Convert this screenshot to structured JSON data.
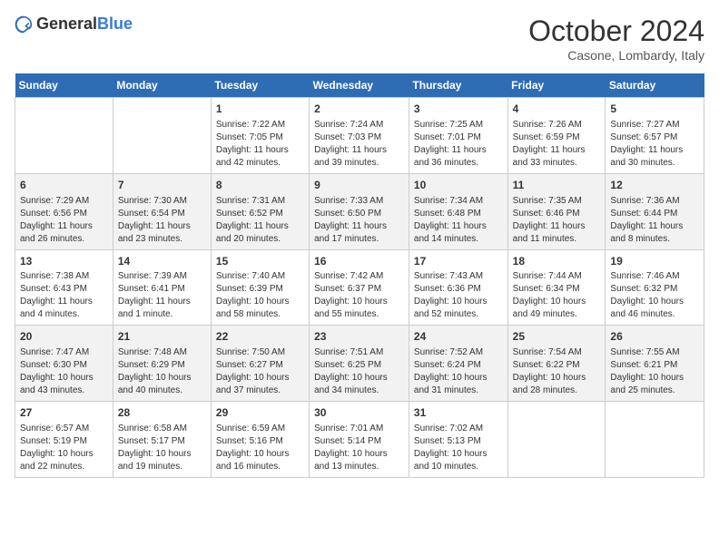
{
  "header": {
    "logo_general": "General",
    "logo_blue": "Blue",
    "month_title": "October 2024",
    "location": "Casone, Lombardy, Italy"
  },
  "weekdays": [
    "Sunday",
    "Monday",
    "Tuesday",
    "Wednesday",
    "Thursday",
    "Friday",
    "Saturday"
  ],
  "weeks": [
    [
      {
        "day": "",
        "sunrise": "",
        "sunset": "",
        "daylight": ""
      },
      {
        "day": "",
        "sunrise": "",
        "sunset": "",
        "daylight": ""
      },
      {
        "day": "1",
        "sunrise": "Sunrise: 7:22 AM",
        "sunset": "Sunset: 7:05 PM",
        "daylight": "Daylight: 11 hours and 42 minutes."
      },
      {
        "day": "2",
        "sunrise": "Sunrise: 7:24 AM",
        "sunset": "Sunset: 7:03 PM",
        "daylight": "Daylight: 11 hours and 39 minutes."
      },
      {
        "day": "3",
        "sunrise": "Sunrise: 7:25 AM",
        "sunset": "Sunset: 7:01 PM",
        "daylight": "Daylight: 11 hours and 36 minutes."
      },
      {
        "day": "4",
        "sunrise": "Sunrise: 7:26 AM",
        "sunset": "Sunset: 6:59 PM",
        "daylight": "Daylight: 11 hours and 33 minutes."
      },
      {
        "day": "5",
        "sunrise": "Sunrise: 7:27 AM",
        "sunset": "Sunset: 6:57 PM",
        "daylight": "Daylight: 11 hours and 30 minutes."
      }
    ],
    [
      {
        "day": "6",
        "sunrise": "Sunrise: 7:29 AM",
        "sunset": "Sunset: 6:56 PM",
        "daylight": "Daylight: 11 hours and 26 minutes."
      },
      {
        "day": "7",
        "sunrise": "Sunrise: 7:30 AM",
        "sunset": "Sunset: 6:54 PM",
        "daylight": "Daylight: 11 hours and 23 minutes."
      },
      {
        "day": "8",
        "sunrise": "Sunrise: 7:31 AM",
        "sunset": "Sunset: 6:52 PM",
        "daylight": "Daylight: 11 hours and 20 minutes."
      },
      {
        "day": "9",
        "sunrise": "Sunrise: 7:33 AM",
        "sunset": "Sunset: 6:50 PM",
        "daylight": "Daylight: 11 hours and 17 minutes."
      },
      {
        "day": "10",
        "sunrise": "Sunrise: 7:34 AM",
        "sunset": "Sunset: 6:48 PM",
        "daylight": "Daylight: 11 hours and 14 minutes."
      },
      {
        "day": "11",
        "sunrise": "Sunrise: 7:35 AM",
        "sunset": "Sunset: 6:46 PM",
        "daylight": "Daylight: 11 hours and 11 minutes."
      },
      {
        "day": "12",
        "sunrise": "Sunrise: 7:36 AM",
        "sunset": "Sunset: 6:44 PM",
        "daylight": "Daylight: 11 hours and 8 minutes."
      }
    ],
    [
      {
        "day": "13",
        "sunrise": "Sunrise: 7:38 AM",
        "sunset": "Sunset: 6:43 PM",
        "daylight": "Daylight: 11 hours and 4 minutes."
      },
      {
        "day": "14",
        "sunrise": "Sunrise: 7:39 AM",
        "sunset": "Sunset: 6:41 PM",
        "daylight": "Daylight: 11 hours and 1 minute."
      },
      {
        "day": "15",
        "sunrise": "Sunrise: 7:40 AM",
        "sunset": "Sunset: 6:39 PM",
        "daylight": "Daylight: 10 hours and 58 minutes."
      },
      {
        "day": "16",
        "sunrise": "Sunrise: 7:42 AM",
        "sunset": "Sunset: 6:37 PM",
        "daylight": "Daylight: 10 hours and 55 minutes."
      },
      {
        "day": "17",
        "sunrise": "Sunrise: 7:43 AM",
        "sunset": "Sunset: 6:36 PM",
        "daylight": "Daylight: 10 hours and 52 minutes."
      },
      {
        "day": "18",
        "sunrise": "Sunrise: 7:44 AM",
        "sunset": "Sunset: 6:34 PM",
        "daylight": "Daylight: 10 hours and 49 minutes."
      },
      {
        "day": "19",
        "sunrise": "Sunrise: 7:46 AM",
        "sunset": "Sunset: 6:32 PM",
        "daylight": "Daylight: 10 hours and 46 minutes."
      }
    ],
    [
      {
        "day": "20",
        "sunrise": "Sunrise: 7:47 AM",
        "sunset": "Sunset: 6:30 PM",
        "daylight": "Daylight: 10 hours and 43 minutes."
      },
      {
        "day": "21",
        "sunrise": "Sunrise: 7:48 AM",
        "sunset": "Sunset: 6:29 PM",
        "daylight": "Daylight: 10 hours and 40 minutes."
      },
      {
        "day": "22",
        "sunrise": "Sunrise: 7:50 AM",
        "sunset": "Sunset: 6:27 PM",
        "daylight": "Daylight: 10 hours and 37 minutes."
      },
      {
        "day": "23",
        "sunrise": "Sunrise: 7:51 AM",
        "sunset": "Sunset: 6:25 PM",
        "daylight": "Daylight: 10 hours and 34 minutes."
      },
      {
        "day": "24",
        "sunrise": "Sunrise: 7:52 AM",
        "sunset": "Sunset: 6:24 PM",
        "daylight": "Daylight: 10 hours and 31 minutes."
      },
      {
        "day": "25",
        "sunrise": "Sunrise: 7:54 AM",
        "sunset": "Sunset: 6:22 PM",
        "daylight": "Daylight: 10 hours and 28 minutes."
      },
      {
        "day": "26",
        "sunrise": "Sunrise: 7:55 AM",
        "sunset": "Sunset: 6:21 PM",
        "daylight": "Daylight: 10 hours and 25 minutes."
      }
    ],
    [
      {
        "day": "27",
        "sunrise": "Sunrise: 6:57 AM",
        "sunset": "Sunset: 5:19 PM",
        "daylight": "Daylight: 10 hours and 22 minutes."
      },
      {
        "day": "28",
        "sunrise": "Sunrise: 6:58 AM",
        "sunset": "Sunset: 5:17 PM",
        "daylight": "Daylight: 10 hours and 19 minutes."
      },
      {
        "day": "29",
        "sunrise": "Sunrise: 6:59 AM",
        "sunset": "Sunset: 5:16 PM",
        "daylight": "Daylight: 10 hours and 16 minutes."
      },
      {
        "day": "30",
        "sunrise": "Sunrise: 7:01 AM",
        "sunset": "Sunset: 5:14 PM",
        "daylight": "Daylight: 10 hours and 13 minutes."
      },
      {
        "day": "31",
        "sunrise": "Sunrise: 7:02 AM",
        "sunset": "Sunset: 5:13 PM",
        "daylight": "Daylight: 10 hours and 10 minutes."
      },
      {
        "day": "",
        "sunrise": "",
        "sunset": "",
        "daylight": ""
      },
      {
        "day": "",
        "sunrise": "",
        "sunset": "",
        "daylight": ""
      }
    ]
  ]
}
